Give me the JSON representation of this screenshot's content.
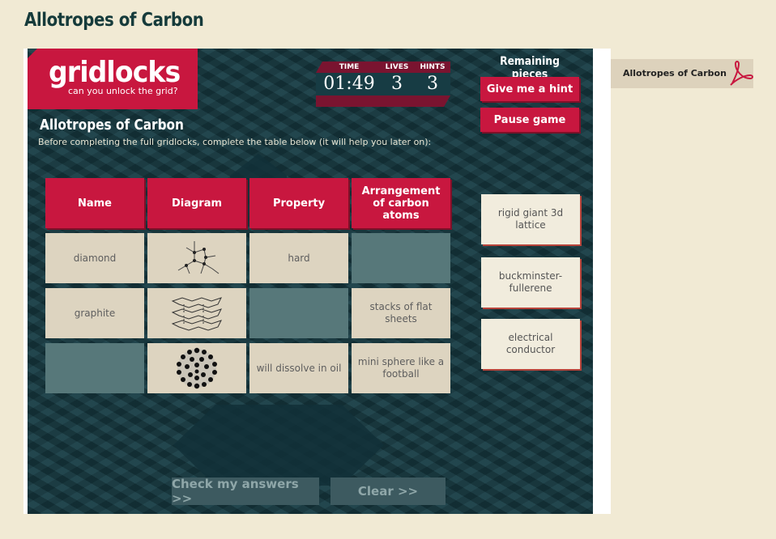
{
  "page": {
    "title": "Allotropes of Carbon"
  },
  "game": {
    "logo": {
      "name": "gridlocks",
      "tagline": "can you unlock the grid?"
    },
    "stats": {
      "time_label": "TIME",
      "time_value": "01:49",
      "lives_label": "LIVES",
      "lives_value": "3",
      "hints_label": "HINTS",
      "hints_value": "3"
    },
    "title": "Allotropes of Carbon",
    "instructions": "Before completing the full gridlocks, complete the table below (it will help you later on):",
    "table": {
      "headers": [
        "Name",
        "Diagram",
        "Property",
        "Arrangement of carbon atoms"
      ],
      "rows": [
        {
          "name": "diamond",
          "diagram": "diamond-structure-icon",
          "property": "hard",
          "arrangement": ""
        },
        {
          "name": "graphite",
          "diagram": "graphite-layers-icon",
          "property": "",
          "arrangement": "stacks of flat sheets"
        },
        {
          "name": "",
          "diagram": "buckminsterfullerene-icon",
          "property": "will dissolve in oil",
          "arrangement": "mini sphere like a football"
        }
      ]
    },
    "sidebar": {
      "title": "Remaining pieces",
      "hint_button": "Give me a hint",
      "pause_button": "Pause game",
      "pieces": [
        "rigid giant 3d lattice",
        "buckminster-fullerene",
        "electrical conductor"
      ]
    },
    "buttons": {
      "check": "Check my answers >>",
      "clear": "Clear >>"
    }
  },
  "attachment": {
    "label": "Allotropes of Carbon",
    "icon": "pdf-icon"
  },
  "colors": {
    "accent": "#c8173f",
    "board": "#173c44",
    "cell": "#ddd4c0",
    "empty_cell": "#57787a",
    "background": "#f1ead4"
  }
}
